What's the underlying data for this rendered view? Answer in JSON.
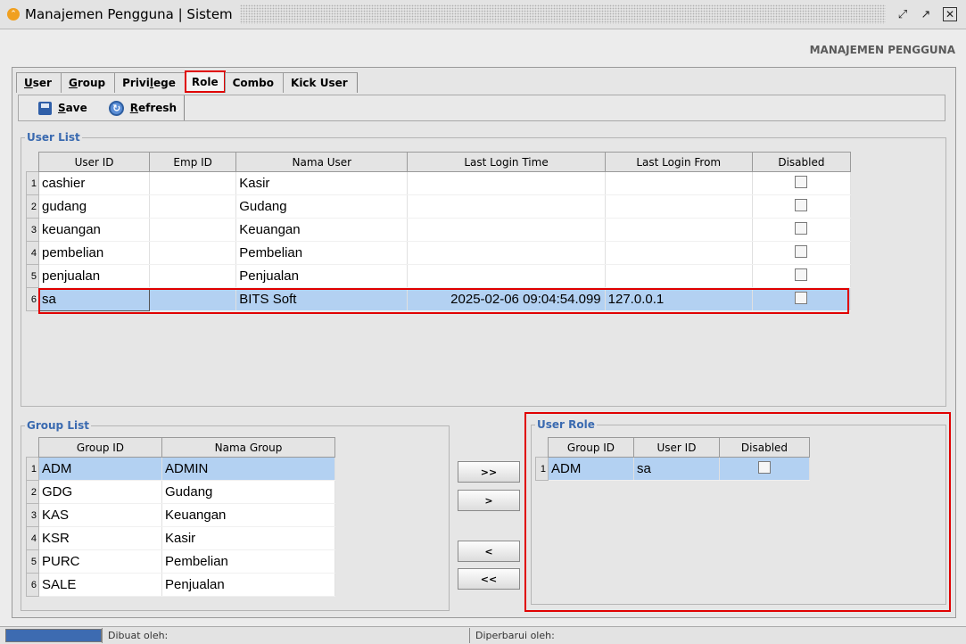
{
  "window": {
    "title": "Manajemen Pengguna | Sistem"
  },
  "header": {
    "title": "MANAJEMEN PENGGUNA"
  },
  "tabs": [
    {
      "label_prefix": "",
      "label_u": "U",
      "label_rest": "ser",
      "active": false
    },
    {
      "label_prefix": "",
      "label_u": "G",
      "label_rest": "roup",
      "active": false
    },
    {
      "label_prefix": "Privi",
      "label_u": "l",
      "label_rest": "ege",
      "active": false
    },
    {
      "label_prefix": "Role",
      "label_u": "",
      "label_rest": "",
      "active": true
    },
    {
      "label_prefix": "Combo",
      "label_u": "",
      "label_rest": "",
      "active": false
    },
    {
      "label_prefix": "Kick User",
      "label_u": "",
      "label_rest": "",
      "active": false
    }
  ],
  "toolbar": {
    "save_u": "S",
    "save_rest": "ave",
    "refresh_u": "R",
    "refresh_rest": "efresh"
  },
  "user_list": {
    "title": "User List",
    "columns": [
      "User ID",
      "Emp ID",
      "Nama User",
      "Last Login Time",
      "Last Login From",
      "Disabled"
    ],
    "rows": [
      {
        "n": "1",
        "user_id": "cashier",
        "emp_id": "",
        "nama": "Kasir",
        "time": "",
        "from": ""
      },
      {
        "n": "2",
        "user_id": "gudang",
        "emp_id": "",
        "nama": "Gudang",
        "time": "",
        "from": ""
      },
      {
        "n": "3",
        "user_id": "keuangan",
        "emp_id": "",
        "nama": "Keuangan",
        "time": "",
        "from": ""
      },
      {
        "n": "4",
        "user_id": "pembelian",
        "emp_id": "",
        "nama": "Pembelian",
        "time": "",
        "from": ""
      },
      {
        "n": "5",
        "user_id": "penjualan",
        "emp_id": "",
        "nama": "Penjualan",
        "time": "",
        "from": ""
      },
      {
        "n": "6",
        "user_id": "sa",
        "emp_id": "",
        "nama": "BITS Soft",
        "time": "2025-02-06 09:04:54.099",
        "from": "127.0.0.1"
      }
    ]
  },
  "group_list": {
    "title": "Group List",
    "columns": [
      "Group ID",
      "Nama Group"
    ],
    "rows": [
      {
        "n": "1",
        "id": "ADM",
        "nama": "ADMIN"
      },
      {
        "n": "2",
        "id": "GDG",
        "nama": "Gudang"
      },
      {
        "n": "3",
        "id": "KAS",
        "nama": "Keuangan"
      },
      {
        "n": "4",
        "id": "KSR",
        "nama": "Kasir"
      },
      {
        "n": "5",
        "id": "PURC",
        "nama": "Pembelian"
      },
      {
        "n": "6",
        "id": "SALE",
        "nama": "Penjualan"
      }
    ]
  },
  "move_buttons": {
    "add_all": ">>",
    "add": ">",
    "remove": "<",
    "remove_all": "<<"
  },
  "user_role": {
    "title": "User Role",
    "columns": [
      "Group ID",
      "User ID",
      "Disabled"
    ],
    "rows": [
      {
        "n": "1",
        "group_id": "ADM",
        "user_id": "sa"
      }
    ]
  },
  "statusbar": {
    "created_by": "Dibuat oleh:",
    "updated_by": "Diperbarui oleh:"
  },
  "colors": {
    "highlight": "#e00000",
    "selection": "#b3d1f2",
    "group_title": "#3a6ab0",
    "progress": "#3d6bb1"
  }
}
